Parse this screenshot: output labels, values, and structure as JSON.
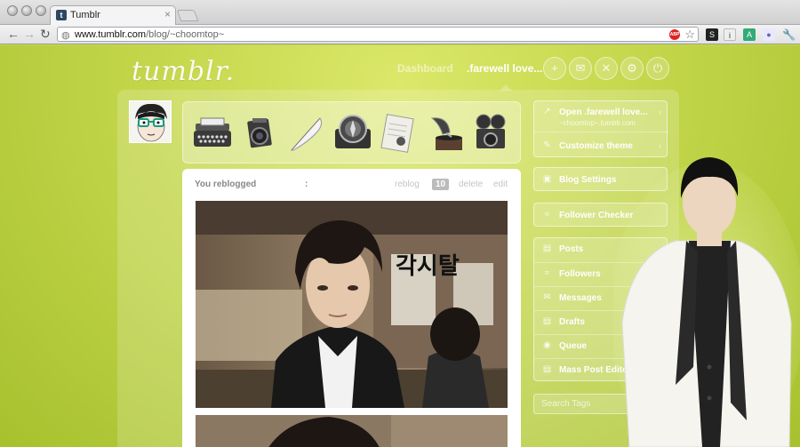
{
  "browser": {
    "tab_title": "Tumblr",
    "tab_favicon": "t",
    "tab_close": "×",
    "url_host": "www.tumblr.com",
    "url_path": "/blog/~choomtop~",
    "back": "←",
    "forward": "→",
    "reload": "↻",
    "star": "☆",
    "abp": "ABP",
    "wrench": "🔧"
  },
  "header": {
    "logo": "tumblr.",
    "dashboard": "Dashboard",
    "blog_name": ".farewell love...",
    "icons": [
      "plus-icon",
      "mail-icon",
      "x-icon",
      "gear-icon",
      "power-icon"
    ]
  },
  "post": {
    "header": "You reblogged",
    "colon": ":",
    "reblog": "reblog",
    "notes": "10",
    "delete": "delete",
    "edit": "edit",
    "photo_title_text": "각시탈"
  },
  "sidebar": {
    "open_blog": ".farewell love...",
    "open_prefix": "Open",
    "open_sub": "~choomtop~.tumblr.com",
    "customize": "Customize theme",
    "blog_settings": "Blog Settings",
    "follower_checker": "Follower Checker",
    "items": [
      {
        "label": "Posts"
      },
      {
        "label": "Followers"
      },
      {
        "label": "Messages"
      },
      {
        "label": "Drafts"
      },
      {
        "label": "Queue"
      },
      {
        "label": "Mass Post Editor"
      }
    ],
    "search_placeholder": "Search Tags"
  },
  "colors": {
    "background": "#c3d64a",
    "accent_text": "#ffffff"
  }
}
